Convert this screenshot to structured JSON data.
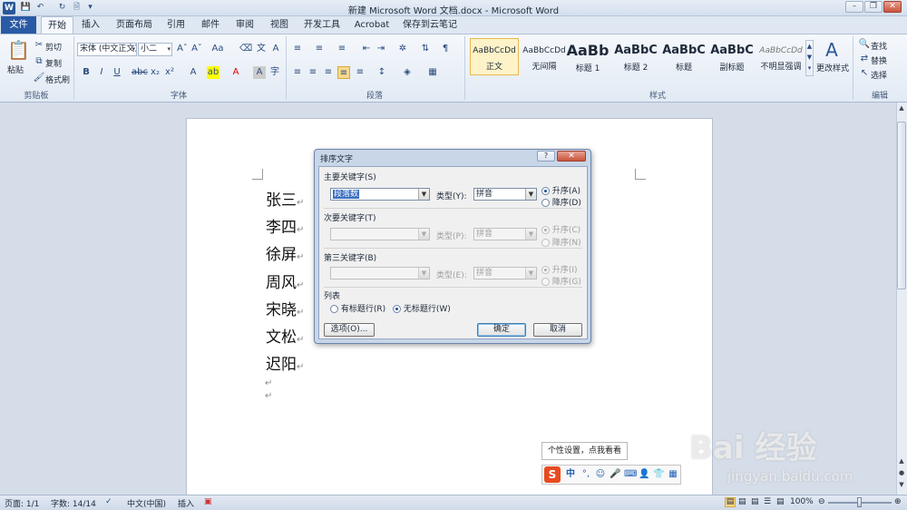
{
  "title_bar": {
    "title": "新建 Microsoft Word 文档.docx - Microsoft Word",
    "app_icon_letter": "W",
    "quick_access": [
      "save-icon",
      "undo-icon",
      "redo-icon",
      "print-preview-icon",
      "customize-icon"
    ],
    "window_buttons": [
      "minimize",
      "restore",
      "close"
    ]
  },
  "tabs": {
    "file": "文件",
    "items": [
      "开始",
      "插入",
      "页面布局",
      "引用",
      "邮件",
      "审阅",
      "视图",
      "开发工具",
      "Acrobat",
      "保存到云笔记"
    ],
    "active": "开始"
  },
  "ribbon": {
    "clipboard": {
      "paste": "粘贴",
      "cut": "剪切",
      "copy": "复制",
      "format_painter": "格式刷",
      "label": "剪贴板"
    },
    "font": {
      "font_name": "宋体 (中文正文)",
      "font_size": "小二",
      "label": "字体"
    },
    "paragraph": {
      "label": "段落"
    },
    "styles": {
      "items": [
        {
          "sample": "AaBbCcDd",
          "name": "正文"
        },
        {
          "sample": "AaBbCcDd",
          "name": "无间隔"
        },
        {
          "sample": "AaBb",
          "name": "标题 1"
        },
        {
          "sample": "AaBbC",
          "name": "标题 2"
        },
        {
          "sample": "AaBbC",
          "name": "标题"
        },
        {
          "sample": "AaBbC",
          "name": "副标题"
        },
        {
          "sample": "AaBbCcDd",
          "name": "不明显强调"
        }
      ],
      "change_styles": "更改样式",
      "label": "样式"
    },
    "editing": {
      "find": "查找",
      "replace": "替换",
      "select": "选择",
      "label": "编辑"
    }
  },
  "document": {
    "lines": [
      "张三",
      "李四",
      "徐屏",
      "周风",
      "宋晓",
      "文松",
      "迟阳"
    ]
  },
  "dialog": {
    "title": "排序文字",
    "primary_key": {
      "label": "主要关键字(S)",
      "value": "段落数",
      "type_label": "类型(Y):",
      "type_value": "拼音",
      "asc": "升序(A)",
      "desc": "降序(D)"
    },
    "secondary_key": {
      "label": "次要关键字(T)",
      "type_label": "类型(P):",
      "type_value": "拼音",
      "asc": "升序(C)",
      "desc": "降序(N)"
    },
    "tertiary_key": {
      "label": "第三关键字(B)",
      "type_label": "类型(E):",
      "type_value": "拼音",
      "asc": "升序(I)",
      "desc": "降序(G)"
    },
    "list": {
      "label": "列表",
      "header_row": "有标题行(R)",
      "no_header_row": "无标题行(W)"
    },
    "options_button": "选项(O)...",
    "ok_button": "确定",
    "cancel_button": "取消"
  },
  "ime": {
    "tooltip": "个性设置，点我看看",
    "logo": "S",
    "mode": "中",
    "icons": [
      "punctuation-icon",
      "emoji-icon",
      "voice-icon",
      "keyboard-icon",
      "user-icon",
      "skin-icon",
      "toolbox-icon"
    ]
  },
  "watermark": {
    "brand": "Bai 经验",
    "url": "jingyan.baidu.com"
  },
  "status_bar": {
    "page": "页面: 1/1",
    "words": "字数: 14/14",
    "language": "中文(中国)",
    "mode": "插入",
    "zoom": "100%"
  },
  "colors": {
    "file_tab": "#2a5aa5",
    "selection": "#3a6fc0",
    "close_button": "#c9543c",
    "ime_logo": "#e94a1f"
  }
}
